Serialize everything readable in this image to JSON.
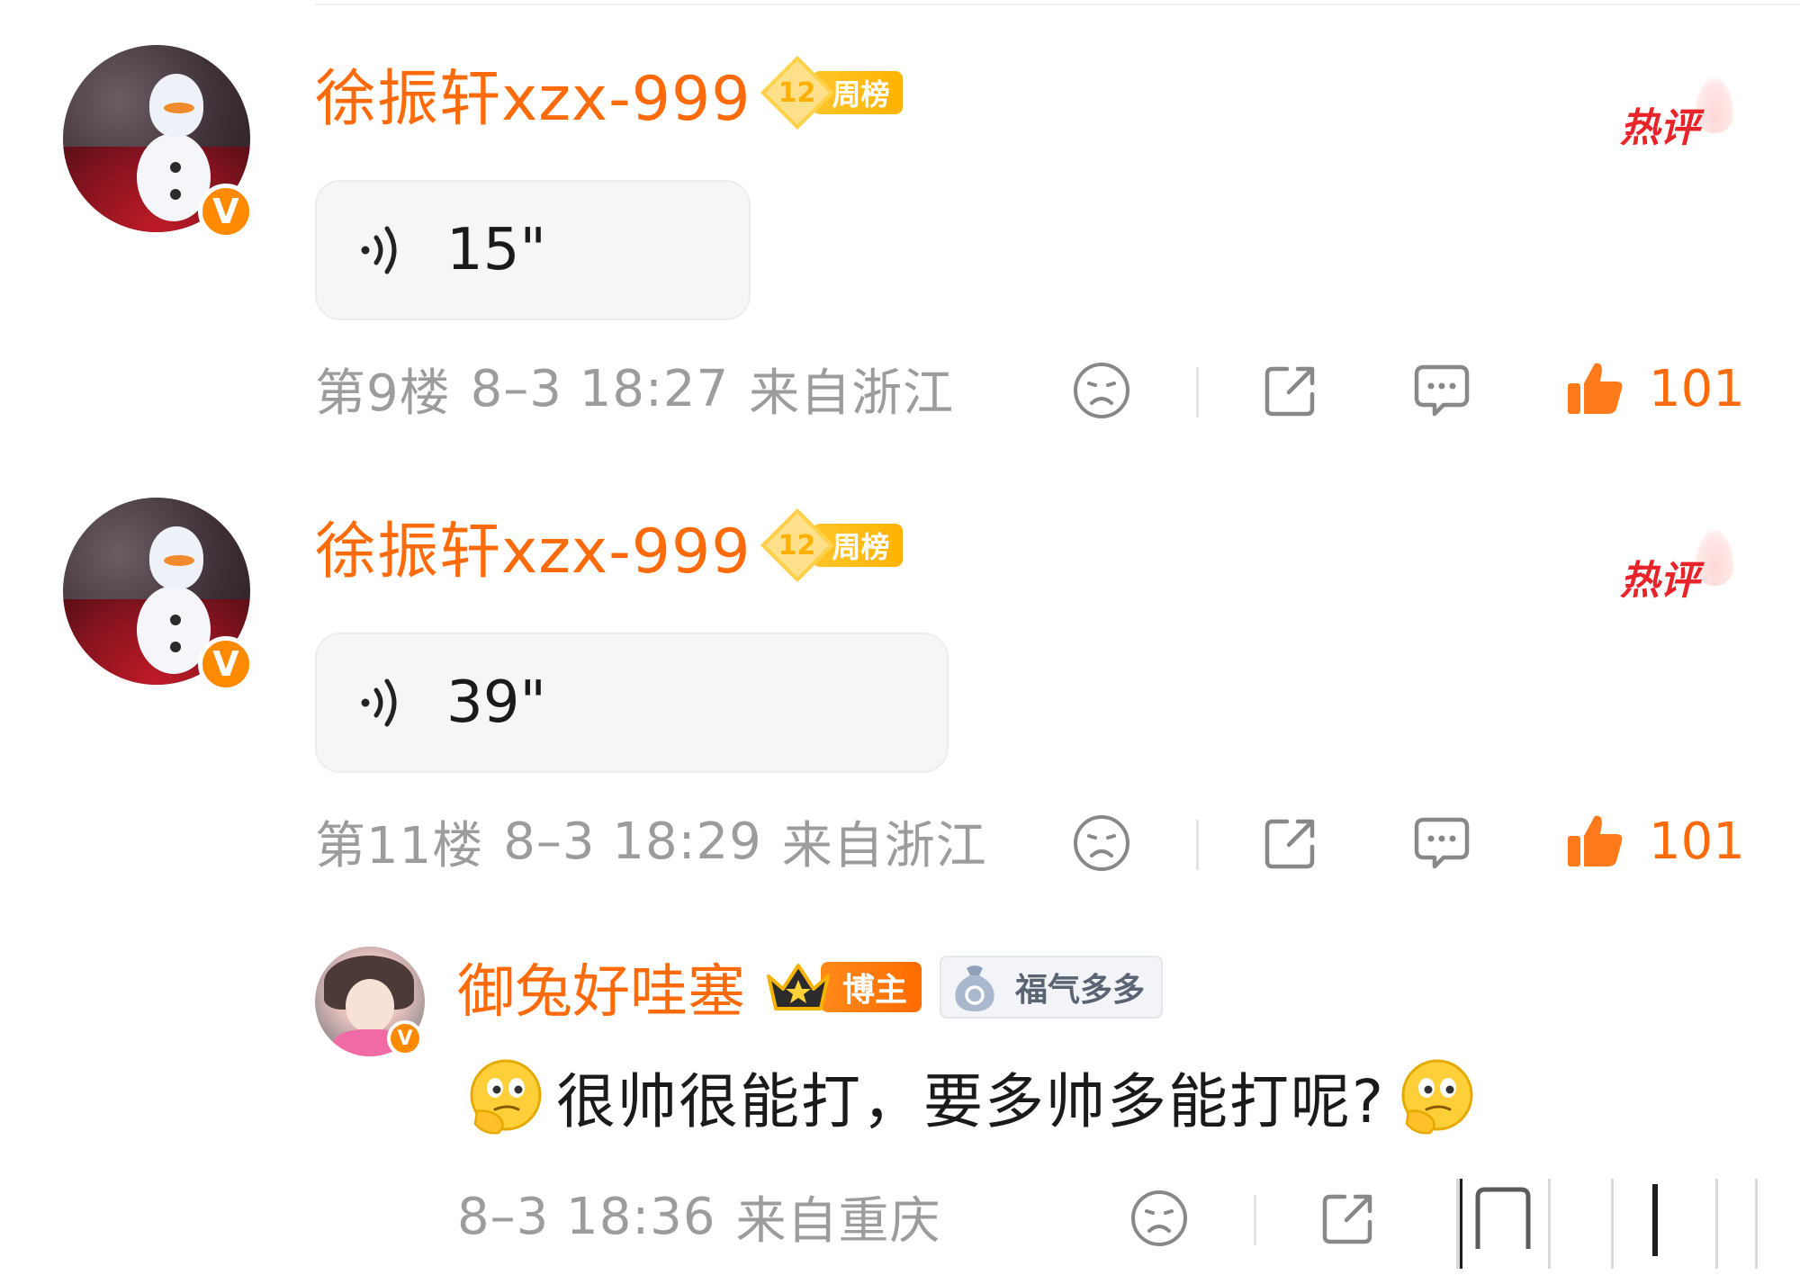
{
  "comments": [
    {
      "username": "徐振轩xzx-999",
      "rank_number": "12",
      "rank_label": "周榜",
      "hot_tag": "热评",
      "voice_duration": "15\"",
      "floor": "第9楼",
      "datetime": "8–3 18:27",
      "location": "来自浙江",
      "like_count": "101"
    },
    {
      "username": "徐振轩xzx-999",
      "rank_number": "12",
      "rank_label": "周榜",
      "hot_tag": "热评",
      "voice_duration": "39\"",
      "floor": "第11楼",
      "datetime": "8–3 18:29",
      "location": "来自浙江",
      "like_count": "101"
    }
  ],
  "reply": {
    "username": "御兔好哇塞",
    "role_badge": "博主",
    "fortune_badge": "福气多多",
    "text": "很帅很能打，要多帅多能打呢?",
    "datetime": "8–3 18:36",
    "location": "来自重庆"
  },
  "icons": {
    "verified": "v-verified-icon",
    "voice": "sound-wave-icon",
    "dislike": "frown-face-icon",
    "share": "share-icon",
    "comment": "comment-bubble-icon",
    "like": "thumbs-up-icon",
    "emoji": "thinking-face-emoji"
  },
  "colors": {
    "accent_orange": "#ff6b0a",
    "hot_red": "#e9232a",
    "meta_gray": "#9c9c9c",
    "rank_gold": "#ffb300"
  }
}
